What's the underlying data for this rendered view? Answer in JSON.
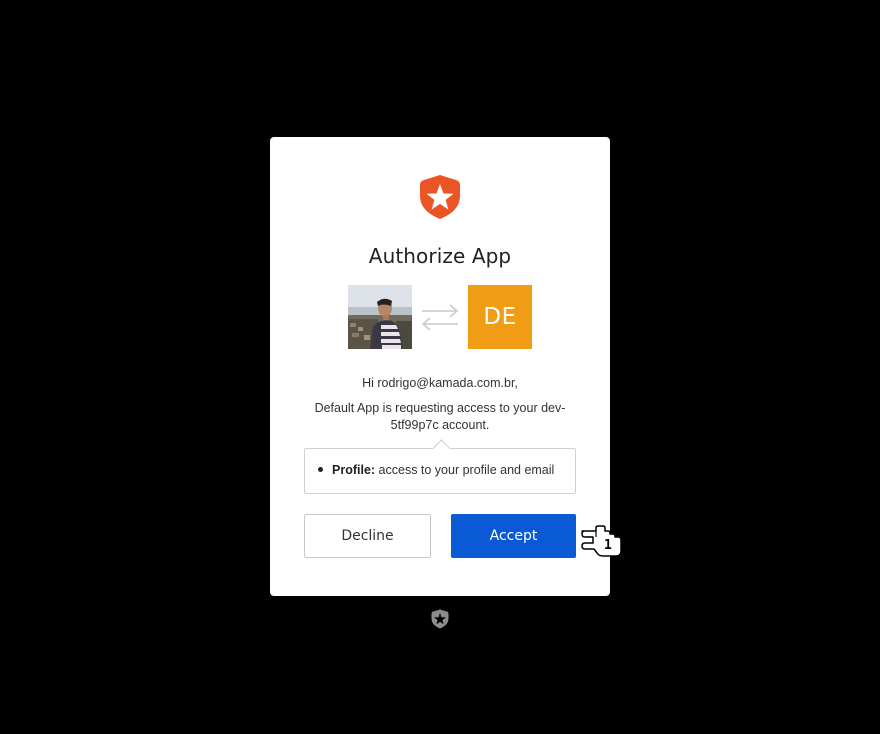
{
  "dialog": {
    "title": "Authorize App",
    "app_initials": "DE",
    "greeting": "Hi rodrigo@kamada.com.br,",
    "request_line1": "Default App is requesting access to your dev-",
    "request_line2": "5tf99p7c account.",
    "scopes": [
      {
        "name": "Profile:",
        "description": " access to your profile and email"
      }
    ],
    "decline_label": "Decline",
    "accept_label": "Accept"
  },
  "cursor": {
    "label": "1"
  },
  "colors": {
    "background": "#000000",
    "brand": "#eb5424",
    "app_avatar": "#f09c14",
    "accept_button": "#0a5ad6"
  },
  "icons": {
    "logo": "auth0-shield-logo",
    "swap": "swap-arrows-icon",
    "cursor": "hand-pointer-cursor",
    "footer": "auth0-footer-logo"
  }
}
